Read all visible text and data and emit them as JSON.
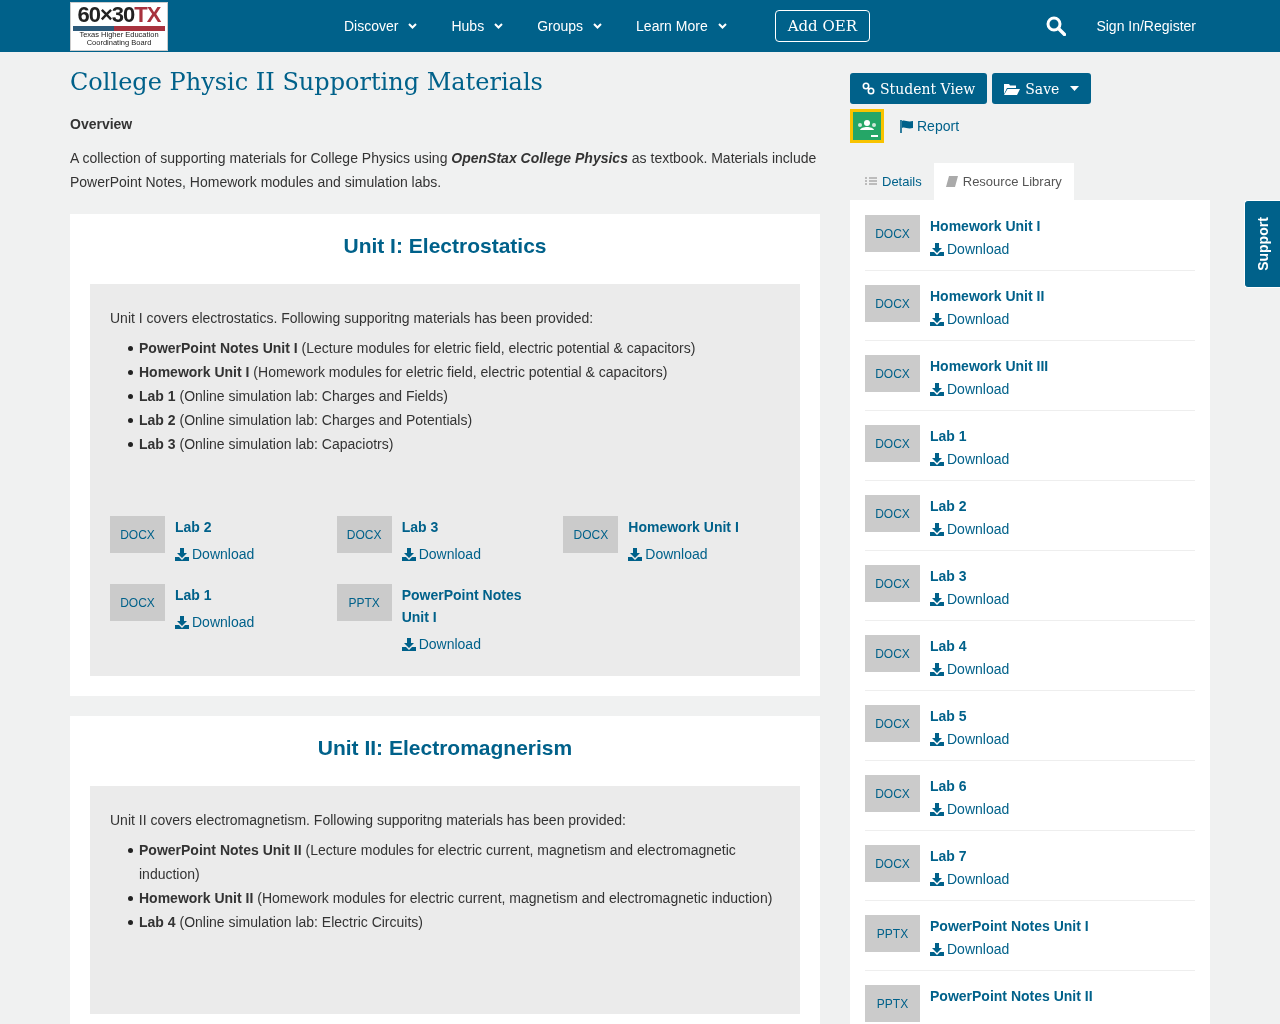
{
  "header": {
    "logo": {
      "mark": "60×30",
      "mark_accent": "TX",
      "caption": "Texas Higher Education Coordinating Board"
    },
    "nav": [
      {
        "label": "Discover",
        "dropdown": true
      },
      {
        "label": "Hubs",
        "dropdown": true
      },
      {
        "label": "Groups",
        "dropdown": true
      },
      {
        "label": "Learn More",
        "dropdown": true
      }
    ],
    "add_button": "Add OER",
    "sign_in": "Sign In/Register"
  },
  "title": "College Physic II Supporting Materials",
  "overview": {
    "heading": "Overview",
    "text": "A collection of supporting materials for College Physics using **OpenStax College Physics** as textbook. Materials include PowerPoint Notes, Homework modules and simulation labs."
  },
  "units": [
    {
      "title": "Unit I: Electrostatics",
      "intro": "Unit I covers electrostatics. Following supporitng materials has been provided:",
      "items": [
        "**PowerPoint Notes Unit I** (Lecture modules for eletric field, electric potential & capacitors)",
        "**Homework Unit I** (Homework modules for eletric field, electric potential & capacitors)",
        "**Lab 1** (Online simulation lab: Charges and Fields)",
        "**Lab 2** (Online simulation lab: Charges and Potentials)",
        "**Lab 3** (Online simulation lab: Capaciotrs)"
      ],
      "resources": [
        {
          "type": "DOCX",
          "name": "Lab 2",
          "action": "Download"
        },
        {
          "type": "DOCX",
          "name": "Lab 3",
          "action": "Download"
        },
        {
          "type": "DOCX",
          "name": "Homework Unit I",
          "action": "Download"
        },
        {
          "type": "DOCX",
          "name": "Lab 1",
          "action": "Download"
        },
        {
          "type": "PPTX",
          "name": "PowerPoint Notes Unit I",
          "action": "Download"
        }
      ]
    },
    {
      "title": "Unit II: Electromagnerism",
      "intro": "Unit II covers electromagnetism. Following supporitng materials has been provided:",
      "items": [
        "**PowerPoint Notes Unit II** (Lecture modules for electric current, magnetism and electromagnetic induction)",
        "**Homework Unit II** (Homework modules for electric current, magnetism and electromagnetic induction)",
        "**Lab 4** (Online simulation lab: Electric Circuits)"
      ]
    }
  ],
  "sidebar": {
    "student_view": "Student View",
    "save": "Save",
    "report": "Report",
    "tabs": [
      {
        "label": "Details",
        "selected": false
      },
      {
        "label": "Resource Library",
        "selected": true
      }
    ],
    "library": [
      {
        "type": "DOCX",
        "name": "Homework Unit I",
        "action": "Download"
      },
      {
        "type": "DOCX",
        "name": "Homework Unit II",
        "action": "Download"
      },
      {
        "type": "DOCX",
        "name": "Homework Unit III",
        "action": "Download"
      },
      {
        "type": "DOCX",
        "name": "Lab 1",
        "action": "Download"
      },
      {
        "type": "DOCX",
        "name": "Lab 2",
        "action": "Download"
      },
      {
        "type": "DOCX",
        "name": "Lab 3",
        "action": "Download"
      },
      {
        "type": "DOCX",
        "name": "Lab 4",
        "action": "Download"
      },
      {
        "type": "DOCX",
        "name": "Lab 5",
        "action": "Download"
      },
      {
        "type": "DOCX",
        "name": "Lab 6",
        "action": "Download"
      },
      {
        "type": "DOCX",
        "name": "Lab 7",
        "action": "Download"
      },
      {
        "type": "PPTX",
        "name": "PowerPoint Notes Unit I",
        "action": "Download"
      },
      {
        "type": "PPTX",
        "name": "PowerPoint Notes Unit II"
      }
    ]
  },
  "support_tab": "Support"
}
